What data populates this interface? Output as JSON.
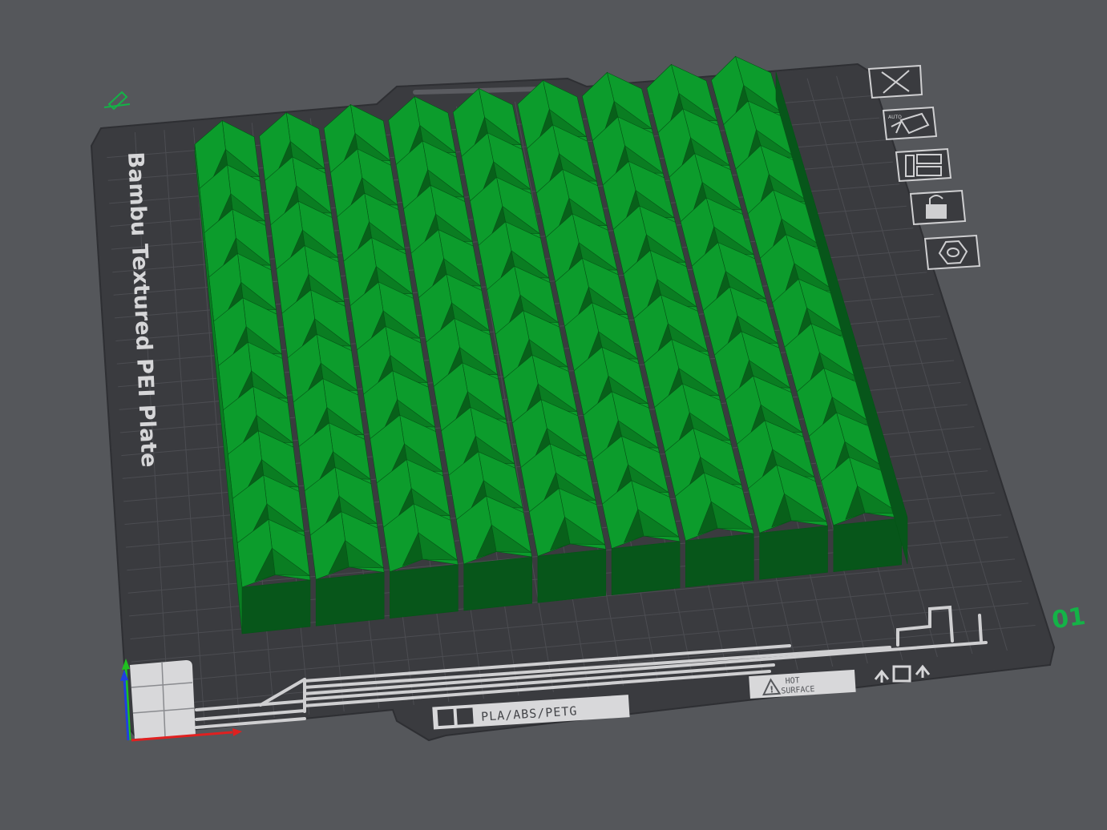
{
  "plate": {
    "name": "Bambu Textured PEI Plate",
    "number": "01",
    "material_label": "PLA/ABS/PETG",
    "hot_line1": "HOT",
    "hot_line2": "SURFACE",
    "auto_label": "AUTO"
  },
  "toolbar": {
    "items": [
      {
        "name": "close-plate-button",
        "icon": "close-icon"
      },
      {
        "name": "auto-orient-button",
        "icon": "auto-orient-icon"
      },
      {
        "name": "arrange-button",
        "icon": "arrange-icon"
      },
      {
        "name": "lock-plate-button",
        "icon": "unlock-icon"
      },
      {
        "name": "plate-settings-button",
        "icon": "hexagon-icon"
      }
    ]
  },
  "model": {
    "rows": 10,
    "cols": 9,
    "colors": {
      "top": "#0c9c2c",
      "left": "#0a7d22",
      "shade": "#08601a",
      "front": "#07561a"
    }
  },
  "colors": {
    "background": "#55575b",
    "plate": "#3a3b3f",
    "grid": "#4c4d52",
    "accent": "#14b347",
    "axis_x": "#e02020",
    "axis_y": "#20c020",
    "axis_z": "#2040e0"
  }
}
